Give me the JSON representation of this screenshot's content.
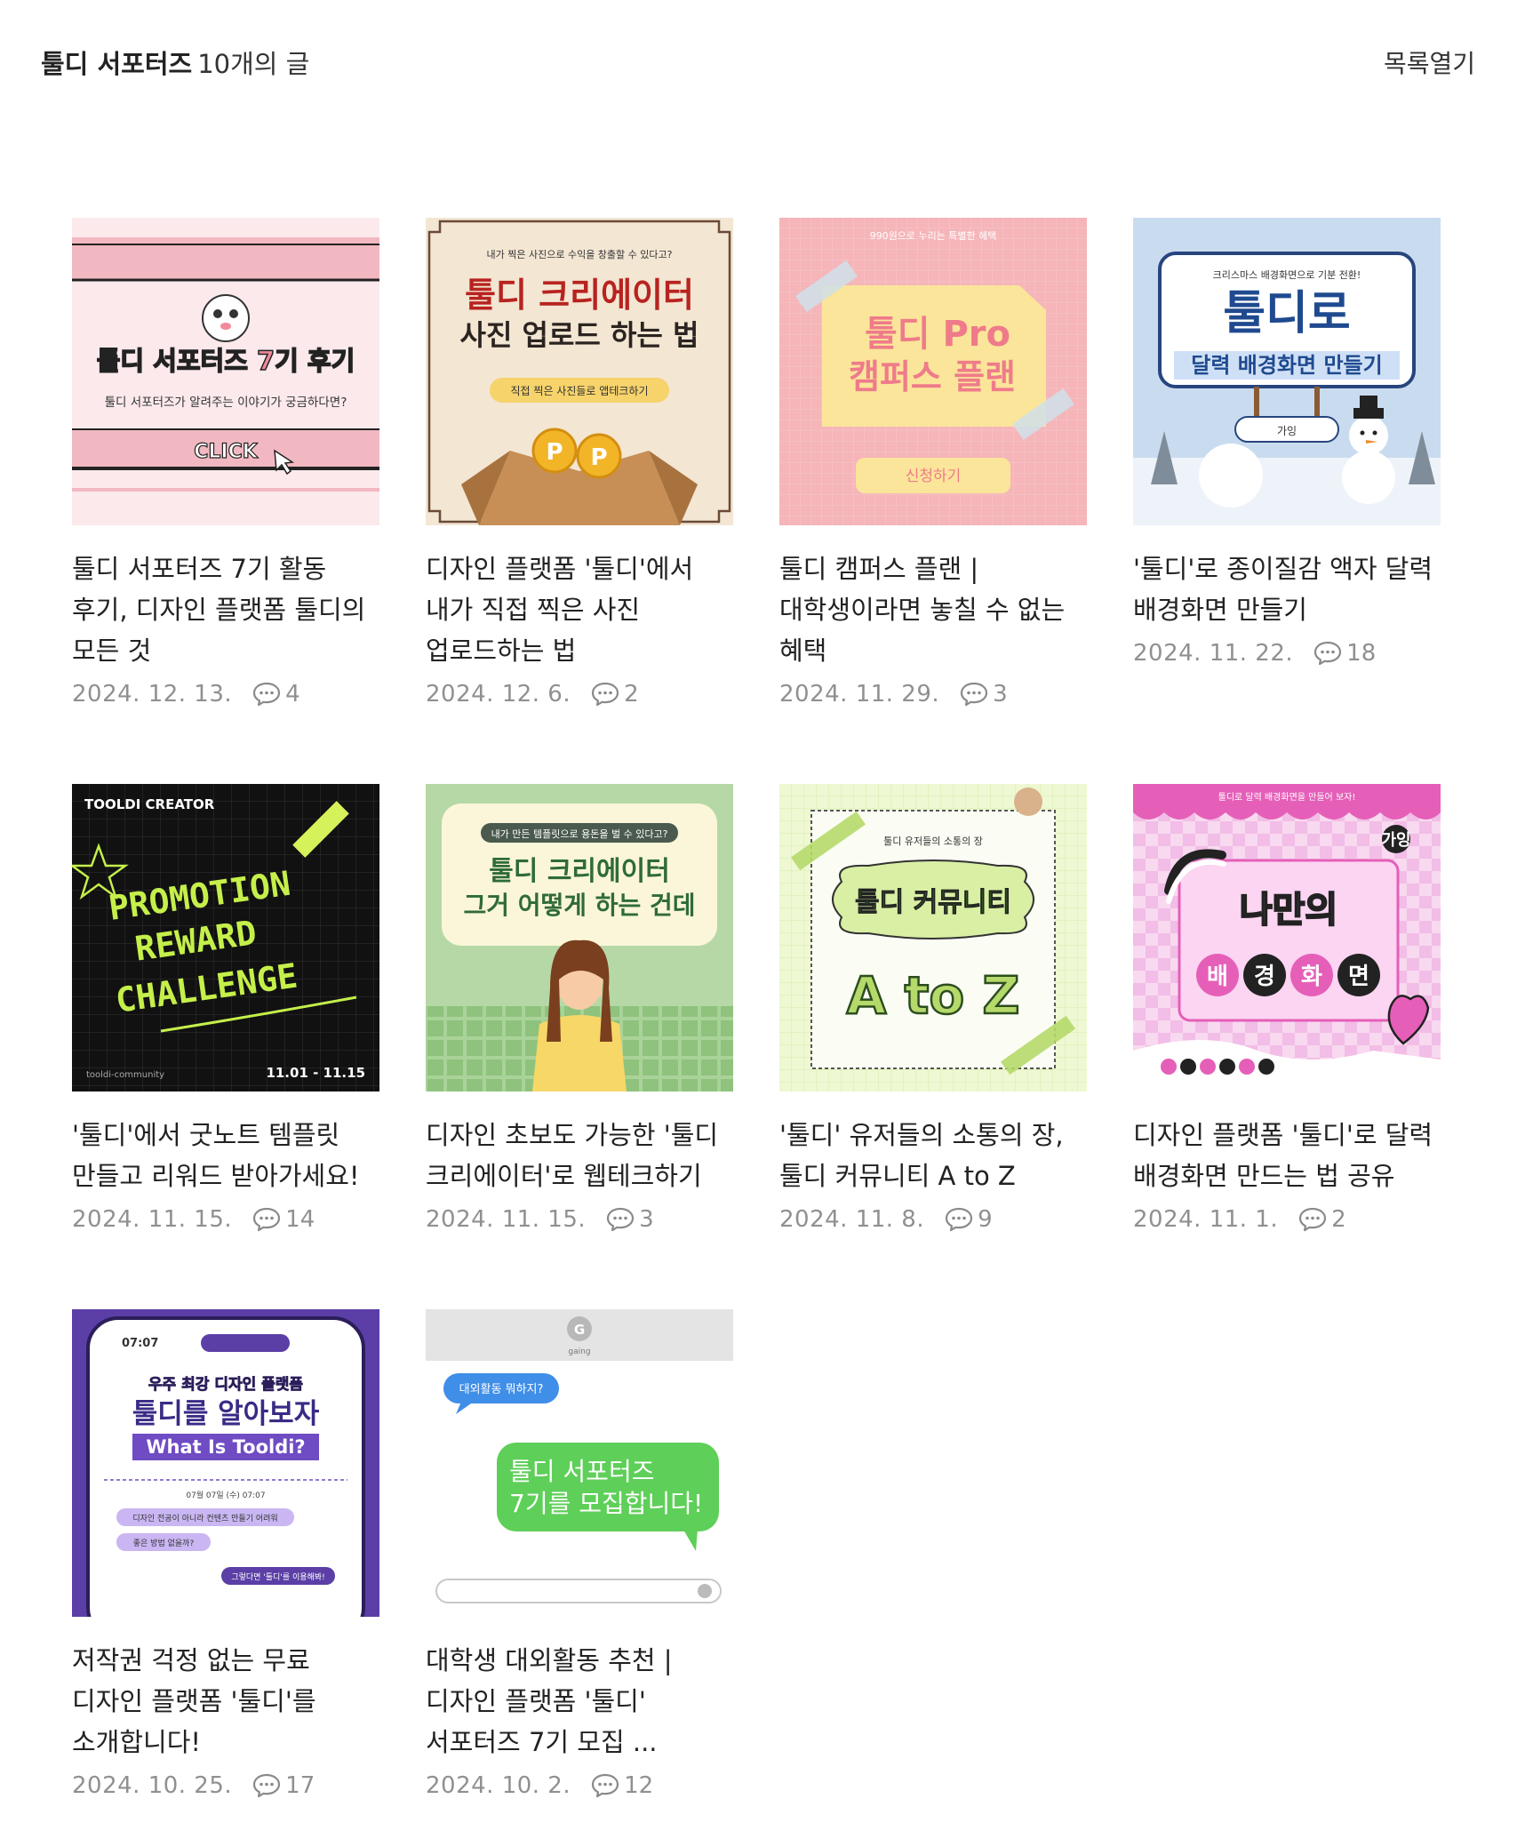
{
  "header": {
    "blog_name": "툴디 서포터즈",
    "post_count": "10개의 글",
    "toggle_label": "목록열기"
  },
  "posts": [
    {
      "title": "툴디 서포터즈 7기 활동 후기, 디자인 플랫폼 툴디의 모든 것",
      "date": "2024. 12. 13.",
      "comments": "4",
      "thumb": {
        "lines": [
          "툴디 서포터즈 7기 후기",
          "툴디 서포터즈가 알려주는 이야기가 궁금하다면?",
          "CLICK"
        ]
      }
    },
    {
      "title": "디자인 플랫폼 '툴디'에서 내가 직접 찍은 사진 업로드하는 법",
      "date": "2024. 12. 6.",
      "comments": "2",
      "thumb": {
        "lines": [
          "내가 찍은 사진으로 수익을 창출할 수 있다고?",
          "툴디 크리에이터",
          "사진 업로드 하는 법",
          "직접 찍은 사진들로 앱테크하기"
        ]
      }
    },
    {
      "title": "툴디 캠퍼스 플랜 | 대학생이라면 놓칠 수 없는 혜택",
      "date": "2024. 11. 29.",
      "comments": "3",
      "thumb": {
        "lines": [
          "990원으로 누리는 특별한 혜택",
          "툴디 Pro",
          "캠퍼스 플랜",
          "신청하기"
        ]
      }
    },
    {
      "title": "'툴디'로 종이질감 액자 달력 배경화면 만들기",
      "date": "2024. 11. 22.",
      "comments": "18",
      "thumb": {
        "lines": [
          "크리스마스 배경화면으로 기분 전환!",
          "툴디로",
          "달력 배경화면 만들기",
          "가잉"
        ]
      }
    },
    {
      "title": "'툴디'에서 굿노트 템플릿 만들고 리워드 받아가세요!",
      "date": "2024. 11. 15.",
      "comments": "14",
      "thumb": {
        "lines": [
          "TOOLDI CREATOR",
          "PROMOTION",
          "REWARD",
          "CHALLENGE",
          "tooldi-community",
          "11.01 - 11.15"
        ]
      }
    },
    {
      "title": "디자인 초보도 가능한 '툴디 크리에이터'로 웹테크하기",
      "date": "2024. 11. 15.",
      "comments": "3",
      "thumb": {
        "lines": [
          "내가 만든 템플릿으로 용돈을 벌 수 있다고?",
          "툴디 크리에이터",
          "그거 어떻게 하는 건데"
        ]
      }
    },
    {
      "title": "'툴디' 유저들의 소통의 장, 툴디 커뮤니티 A to Z",
      "date": "2024. 11. 8.",
      "comments": "9",
      "thumb": {
        "lines": [
          "툴디 유저들의 소통의 장",
          "툴디 커뮤니티",
          "A to Z"
        ]
      }
    },
    {
      "title": "디자인 플랫폼 '툴디'로 달력 배경화면 만드는 법 공유",
      "date": "2024. 11. 1.",
      "comments": "2",
      "thumb": {
        "lines": [
          "툴디로 달력 배경화면을 만들어 보자!",
          "나만의",
          "배",
          "경",
          "화",
          "면",
          "가잉"
        ]
      }
    },
    {
      "title": "저작권 걱정 없는 무료 디자인 플랫폼 '툴디'를 소개합니다!",
      "date": "2024. 10. 25.",
      "comments": "17",
      "thumb": {
        "lines": [
          "07:07",
          "우주 최강 디자인 플랫폼",
          "툴디를 알아보자",
          "What Is Tooldi?",
          "07월 07일 (수) 07:07",
          "디자인 전공이 아니라 컨텐츠 만들기 어려워",
          "좋은 방법 없을까?",
          "그렇다면 '툴디'를 이용해봐!"
        ]
      }
    },
    {
      "title": "대학생 대외활동 추천 | 디자인 플랫폼 '툴디' 서포터즈 7기 모집 ...",
      "date": "2024. 10. 2.",
      "comments": "12",
      "thumb": {
        "lines": [
          "G",
          "gaing",
          "대외활동 뭐하지?",
          "툴디 서포터즈",
          "7기를 모집합니다!"
        ]
      }
    }
  ]
}
